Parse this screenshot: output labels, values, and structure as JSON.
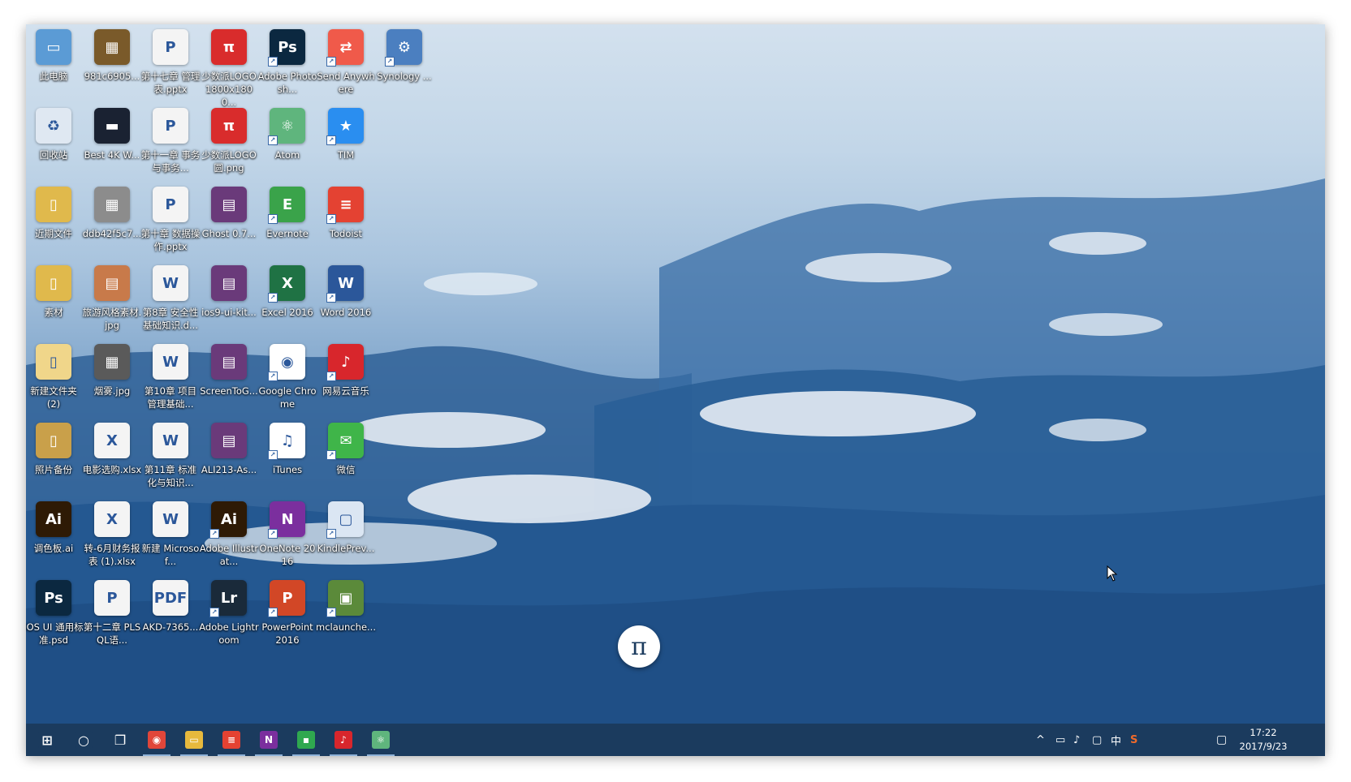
{
  "desktop": {
    "icons": [
      {
        "label": "此电脑",
        "color": "#5b9bd5",
        "glyph": "▭",
        "icon": "computer-icon",
        "shortcut": false
      },
      {
        "label": "981c6905...",
        "color": "#7a5a2a",
        "glyph": "▦",
        "icon": "image-file-icon",
        "shortcut": false
      },
      {
        "label": "第十七章 管理表.pptx",
        "color": "#f4f4f4",
        "glyph": "P",
        "icon": "pptx-file-icon",
        "shortcut": false
      },
      {
        "label": "少数派LOGO 1800x1800...",
        "color": "#d92c2c",
        "glyph": "π",
        "icon": "sspai-logo-file-icon",
        "shortcut": false
      },
      {
        "label": "Adobe Photosh...",
        "color": "#0b2840",
        "glyph": "Ps",
        "icon": "photoshop-icon",
        "shortcut": true
      },
      {
        "label": "Send Anywhere",
        "color": "#f05a4a",
        "glyph": "⇄",
        "icon": "send-anywhere-icon",
        "shortcut": true
      },
      {
        "label": "Synology ...",
        "color": "#4b7fc0",
        "glyph": "⚙",
        "icon": "synology-icon",
        "shortcut": true
      },
      {
        "label": "回收站",
        "color": "#dfe8f2",
        "glyph": "♻",
        "icon": "recycle-bin-icon",
        "shortcut": false
      },
      {
        "label": "Best 4K W...",
        "color": "#1a2232",
        "glyph": "▬",
        "icon": "wallpaper-file-icon",
        "shortcut": false
      },
      {
        "label": "第十一章 事务与事务...",
        "color": "#f4f4f4",
        "glyph": "P",
        "icon": "pptx-file-icon",
        "shortcut": false
      },
      {
        "label": "少数派LOGO 圆.png",
        "color": "#d92c2c",
        "glyph": "π",
        "icon": "sspai-round-logo-icon",
        "shortcut": false
      },
      {
        "label": "Atom",
        "color": "#5fb57d",
        "glyph": "⚛",
        "icon": "atom-icon",
        "shortcut": true
      },
      {
        "label": "TIM",
        "color": "#2a8ef0",
        "glyph": "★",
        "icon": "tim-icon",
        "shortcut": true
      },
      {
        "label": "近期文件",
        "color": "#e0b94c",
        "glyph": "▯",
        "icon": "folder-icon",
        "shortcut": false
      },
      {
        "label": "ddb42f5c7...",
        "color": "#8c8c8c",
        "glyph": "▦",
        "icon": "image-file-icon",
        "shortcut": false
      },
      {
        "label": "第十章 数据操作.pptx",
        "color": "#f4f4f4",
        "glyph": "P",
        "icon": "pptx-file-icon",
        "shortcut": false
      },
      {
        "label": "Ghost 0.7...",
        "color": "#6a3a7a",
        "glyph": "▤",
        "icon": "winrar-archive-icon",
        "shortcut": false
      },
      {
        "label": "Evernote",
        "color": "#3aa34a",
        "glyph": "E",
        "icon": "evernote-icon",
        "shortcut": true
      },
      {
        "label": "Todoist",
        "color": "#e44232",
        "glyph": "≡",
        "icon": "todoist-icon",
        "shortcut": true
      },
      {
        "label": "素材",
        "color": "#e0b94c",
        "glyph": "▯",
        "icon": "folder-icon",
        "shortcut": false
      },
      {
        "label": "旅游风格素材.jpg",
        "color": "#c87a4a",
        "glyph": "▤",
        "icon": "image-file-icon",
        "shortcut": false
      },
      {
        "label": "第8章 安全性基础知识.d...",
        "color": "#f4f4f4",
        "glyph": "W",
        "icon": "word-file-icon",
        "shortcut": false
      },
      {
        "label": "ios9-ui-kit...",
        "color": "#6a3a7a",
        "glyph": "▤",
        "icon": "winrar-archive-icon",
        "shortcut": false
      },
      {
        "label": "Excel 2016",
        "color": "#1f7244",
        "glyph": "X",
        "icon": "excel-icon",
        "shortcut": true
      },
      {
        "label": "Word 2016",
        "color": "#2b579a",
        "glyph": "W",
        "icon": "word-icon",
        "shortcut": true
      },
      {
        "label": "新建文件夹 (2)",
        "color": "#f0d68a",
        "glyph": "▯",
        "icon": "folder-icon",
        "shortcut": false
      },
      {
        "label": "烟雾.jpg",
        "color": "#5a5a5a",
        "glyph": "▦",
        "icon": "image-file-icon",
        "shortcut": false
      },
      {
        "label": "第10章 项目管理基础...",
        "color": "#f4f4f4",
        "glyph": "W",
        "icon": "word-file-icon",
        "shortcut": false
      },
      {
        "label": "ScreenToG...",
        "color": "#6a3a7a",
        "glyph": "▤",
        "icon": "winrar-archive-icon",
        "shortcut": false
      },
      {
        "label": "Google Chrome",
        "color": "#ffffff",
        "glyph": "◉",
        "icon": "chrome-icon",
        "shortcut": true
      },
      {
        "label": "网易云音乐",
        "color": "#d8262c",
        "glyph": "♪",
        "icon": "netease-music-icon",
        "shortcut": true
      },
      {
        "label": "照片备份",
        "color": "#c9a04a",
        "glyph": "▯",
        "icon": "folder-icon",
        "shortcut": false
      },
      {
        "label": "电影选购.xlsx",
        "color": "#f4f4f4",
        "glyph": "X",
        "icon": "excel-file-icon",
        "shortcut": false
      },
      {
        "label": "第11章 标准化与知识...",
        "color": "#f4f4f4",
        "glyph": "W",
        "icon": "word-file-icon",
        "shortcut": false
      },
      {
        "label": "ALI213-As...",
        "color": "#6a3a7a",
        "glyph": "▤",
        "icon": "winrar-archive-icon",
        "shortcut": false
      },
      {
        "label": "iTunes",
        "color": "#ffffff",
        "glyph": "♫",
        "icon": "itunes-icon",
        "shortcut": true
      },
      {
        "label": "微信",
        "color": "#3fb549",
        "glyph": "✉",
        "icon": "wechat-icon",
        "shortcut": true
      },
      {
        "label": "调色板.ai",
        "color": "#2e1a05",
        "glyph": "Ai",
        "icon": "illustrator-file-icon",
        "shortcut": false
      },
      {
        "label": "转-6月财务报表 (1).xlsx",
        "color": "#f4f4f4",
        "glyph": "X",
        "icon": "excel-file-icon",
        "shortcut": false
      },
      {
        "label": "新建 Microsof...",
        "color": "#f4f4f4",
        "glyph": "W",
        "icon": "word-file-icon",
        "shortcut": false
      },
      {
        "label": "Adobe Illustrat...",
        "color": "#2e1a05",
        "glyph": "Ai",
        "icon": "illustrator-icon",
        "shortcut": true
      },
      {
        "label": "OneNote 2016",
        "color": "#7b2f9e",
        "glyph": "N",
        "icon": "onenote-icon",
        "shortcut": true
      },
      {
        "label": "KindlePrev...",
        "color": "#dbe6f3",
        "glyph": "▢",
        "icon": "kindle-previewer-icon",
        "shortcut": true
      },
      {
        "label": "iOS UI 通用标准.psd",
        "color": "#0b2840",
        "glyph": "Ps",
        "icon": "psd-file-icon",
        "shortcut": false
      },
      {
        "label": "第十二章 PLSQL语...",
        "color": "#f4f4f4",
        "glyph": "P",
        "icon": "pptx-file-icon",
        "shortcut": false
      },
      {
        "label": "AKD-7365...",
        "color": "#f4f4f4",
        "glyph": "PDF",
        "icon": "pdf-file-icon",
        "shortcut": false
      },
      {
        "label": "Adobe Lightroom",
        "color": "#1a2a3a",
        "glyph": "Lr",
        "icon": "lightroom-icon",
        "shortcut": true
      },
      {
        "label": "PowerPoint 2016",
        "color": "#d24726",
        "glyph": "P",
        "icon": "powerpoint-icon",
        "shortcut": true
      },
      {
        "label": "mclaunche...",
        "color": "#5b8a3a",
        "glyph": "▣",
        "icon": "minecraft-launcher-icon",
        "shortcut": true
      }
    ]
  },
  "floating_button": {
    "glyph": "π"
  },
  "taskbar": {
    "items": [
      {
        "name": "start-button",
        "glyph": "⊞",
        "color": "#1b3b5e"
      },
      {
        "name": "cortana-search-button",
        "glyph": "○",
        "color": "#1b3b5e"
      },
      {
        "name": "task-view-button",
        "glyph": "❐",
        "color": "#1b3b5e"
      },
      {
        "name": "taskbar-chrome",
        "glyph": "◉",
        "color": "#e0463a"
      },
      {
        "name": "taskbar-file-explorer",
        "glyph": "▭",
        "color": "#e7b93d"
      },
      {
        "name": "taskbar-todoist",
        "glyph": "≡",
        "color": "#e44232"
      },
      {
        "name": "taskbar-onenote",
        "glyph": "N",
        "color": "#7b2f9e"
      },
      {
        "name": "taskbar-green-app",
        "glyph": "▪",
        "color": "#2fa84f"
      },
      {
        "name": "taskbar-netease-music",
        "glyph": "♪",
        "color": "#d8262c"
      },
      {
        "name": "taskbar-atom",
        "glyph": "⚛",
        "color": "#5fb57d"
      }
    ],
    "tray": {
      "chevron": "^",
      "battery": "▭",
      "volume": "♪",
      "network": "▢",
      "ime": "中",
      "sogou": "S"
    },
    "clock": {
      "time": "17:22",
      "date": "2017/9/23"
    },
    "notifications": "▢"
  }
}
